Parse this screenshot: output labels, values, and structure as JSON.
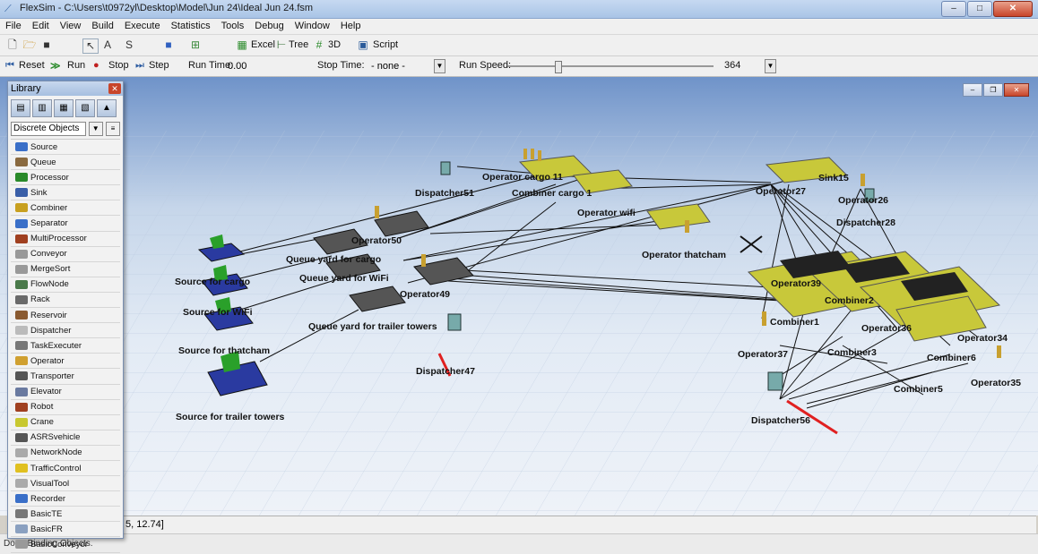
{
  "window": {
    "title": "FlexSim - C:\\Users\\t0972yl\\Desktop\\Model\\Jun 24\\Ideal Jun 24.fsm",
    "minimize": "–",
    "maximize": "□",
    "close": "✕"
  },
  "menu": [
    "File",
    "Edit",
    "View",
    "Build",
    "Execute",
    "Statistics",
    "Tools",
    "Debug",
    "Window",
    "Help"
  ],
  "toolbar": {
    "excel": "Excel",
    "tree": "Tree",
    "threed": "3D",
    "script": "Script"
  },
  "run_controls": {
    "reset": "Reset",
    "run": "Run",
    "stop": "Stop",
    "step": "Step",
    "run_time_label": "Run Time:",
    "run_time_value": "0.00",
    "stop_time_label": "Stop Time:",
    "stop_time_value": "- none -",
    "run_speed_label": "Run Speed:",
    "run_speed_value": "364"
  },
  "library": {
    "title": "Library",
    "group": "Discrete Objects",
    "items": [
      {
        "label": "Source",
        "color": "#3a6fc8"
      },
      {
        "label": "Queue",
        "color": "#8a6a40"
      },
      {
        "label": "Processor",
        "color": "#2a8a2a"
      },
      {
        "label": "Sink",
        "color": "#3a5fa8"
      },
      {
        "label": "Combiner",
        "color": "#c8a020"
      },
      {
        "label": "Separator",
        "color": "#3a6fc8"
      },
      {
        "label": "MultiProcessor",
        "color": "#a04020"
      },
      {
        "label": "Conveyor",
        "color": "#999999"
      },
      {
        "label": "MergeSort",
        "color": "#999999"
      },
      {
        "label": "FlowNode",
        "color": "#4a7a4a"
      },
      {
        "label": "Rack",
        "color": "#6a6a6a"
      },
      {
        "label": "Reservoir",
        "color": "#8a5a30"
      },
      {
        "label": "Dispatcher",
        "color": "#bbbbbb"
      },
      {
        "label": "TaskExecuter",
        "color": "#777777"
      },
      {
        "label": "Operator",
        "color": "#d0a030"
      },
      {
        "label": "Transporter",
        "color": "#555555"
      },
      {
        "label": "Elevator",
        "color": "#6a7aa0"
      },
      {
        "label": "Robot",
        "color": "#a04020"
      },
      {
        "label": "Crane",
        "color": "#c8c830"
      },
      {
        "label": "ASRSvehicle",
        "color": "#555555"
      },
      {
        "label": "NetworkNode",
        "color": "#aaaaaa"
      },
      {
        "label": "TrafficControl",
        "color": "#e0c020"
      },
      {
        "label": "VisualTool",
        "color": "#aaaaaa"
      },
      {
        "label": "Recorder",
        "color": "#3a6fc8"
      },
      {
        "label": "BasicTE",
        "color": "#777777"
      },
      {
        "label": "BasicFR",
        "color": "#8aa0c0"
      },
      {
        "label": "BasicConveyor",
        "color": "#999999"
      }
    ]
  },
  "model_labels": {
    "operator_cargo": "Operator cargo 11",
    "dispatcher51": "Dispatcher51",
    "combiner_cargo": "Combiner cargo 1",
    "operator_wifi": "Operator wifi",
    "sink15": "Sink15",
    "operator27": "Operator27",
    "operator26": "Operator26",
    "dispatcher28": "Dispatcher28",
    "operator50": "Operator50",
    "operator_thatcham": "Operator thatcham",
    "queue_cargo": "Queue yard for cargo",
    "source_cargo": "Source for cargo",
    "queue_wifi": "Queue yard for WiFi",
    "operator49": "Operator49",
    "source_wifi": "Source for WiFi",
    "queue_trailer": "Queue yard for trailer towers",
    "source_thatcham": "Source for thatcham",
    "dispatcher47": "Dispatcher47",
    "source_trailer": "Source for trailer towers",
    "operator39": "Operator39",
    "combiner2": "Combiner2",
    "combiner1": "Combiner1",
    "operator36": "Operator36",
    "operator34": "Operator34",
    "operator37": "Operator37",
    "combiner3": "Combiner3",
    "combiner6": "Combiner6",
    "operator35": "Operator35",
    "combiner5": "Combiner5",
    "dispatcher56": "Dispatcher56"
  },
  "coord_readout": "5, 12.74]",
  "status": "Done Binding Objects."
}
